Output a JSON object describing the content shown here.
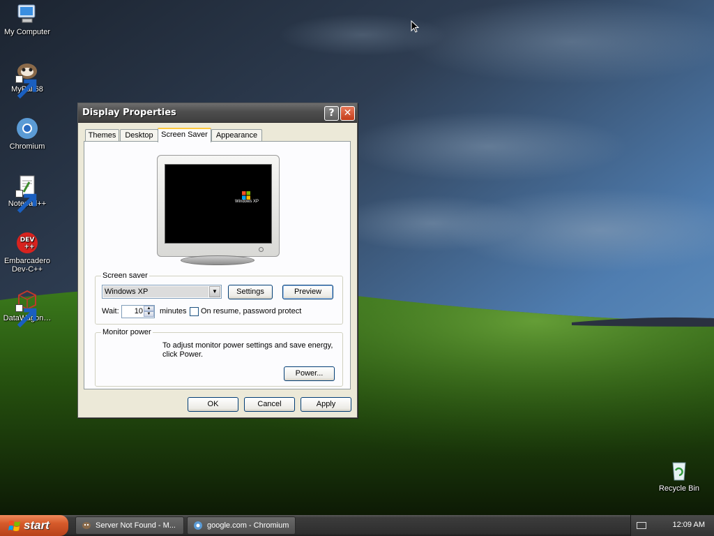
{
  "desktop": {
    "icons": [
      {
        "label": "My Computer",
        "icon": "my-computer-icon"
      },
      {
        "label": "MyPal 68",
        "icon": "mypal-icon"
      },
      {
        "label": "Chromium",
        "icon": "chromium-icon"
      },
      {
        "label": "Notepad++",
        "icon": "notepad-plus-plus-icon"
      },
      {
        "label": "Embarcadero Dev-C++",
        "icon": "dev-cpp-icon",
        "line1": "Embarcadero",
        "line2": "Dev-C++",
        "badge": "DEV\n++"
      },
      {
        "label": "DataWagon…",
        "icon": "datawagon-icon"
      },
      {
        "label": "Recycle Bin",
        "icon": "recycle-bin-icon"
      }
    ]
  },
  "dialog": {
    "title": "Display Properties",
    "help_glyph": "?",
    "close_glyph": "✕",
    "tabs": [
      {
        "label": "Themes",
        "active": false
      },
      {
        "label": "Desktop",
        "active": false
      },
      {
        "label": "Screen Saver",
        "active": true
      },
      {
        "label": "Appearance",
        "active": false
      }
    ],
    "preview": {
      "logo_text": "Windows XP"
    },
    "screen_saver": {
      "group_label": "Screen saver",
      "selected": "Windows XP",
      "settings_label": "Settings",
      "preview_label": "Preview",
      "wait_label": "Wait:",
      "wait_value": "10",
      "minutes_label": "minutes",
      "password_label": "On resume, password protect",
      "password_checked": false
    },
    "monitor_power": {
      "group_label": "Monitor power",
      "description": "To adjust monitor power settings and save energy, click Power.",
      "power_label": "Power..."
    },
    "buttons": {
      "ok": "OK",
      "cancel": "Cancel",
      "apply": "Apply"
    }
  },
  "taskbar": {
    "start_label": "start",
    "items": [
      {
        "label": "Server Not Found - M...",
        "icon": "mypal-icon"
      },
      {
        "label": "google.com - Chromium",
        "icon": "chromium-icon"
      }
    ],
    "clock": "12:09 AM",
    "tray_icon": "keyboard-icon"
  },
  "colors": {
    "accent_tab": "#ffc83c",
    "start_button": "#d55a2a",
    "close_button": "#c43c18"
  }
}
